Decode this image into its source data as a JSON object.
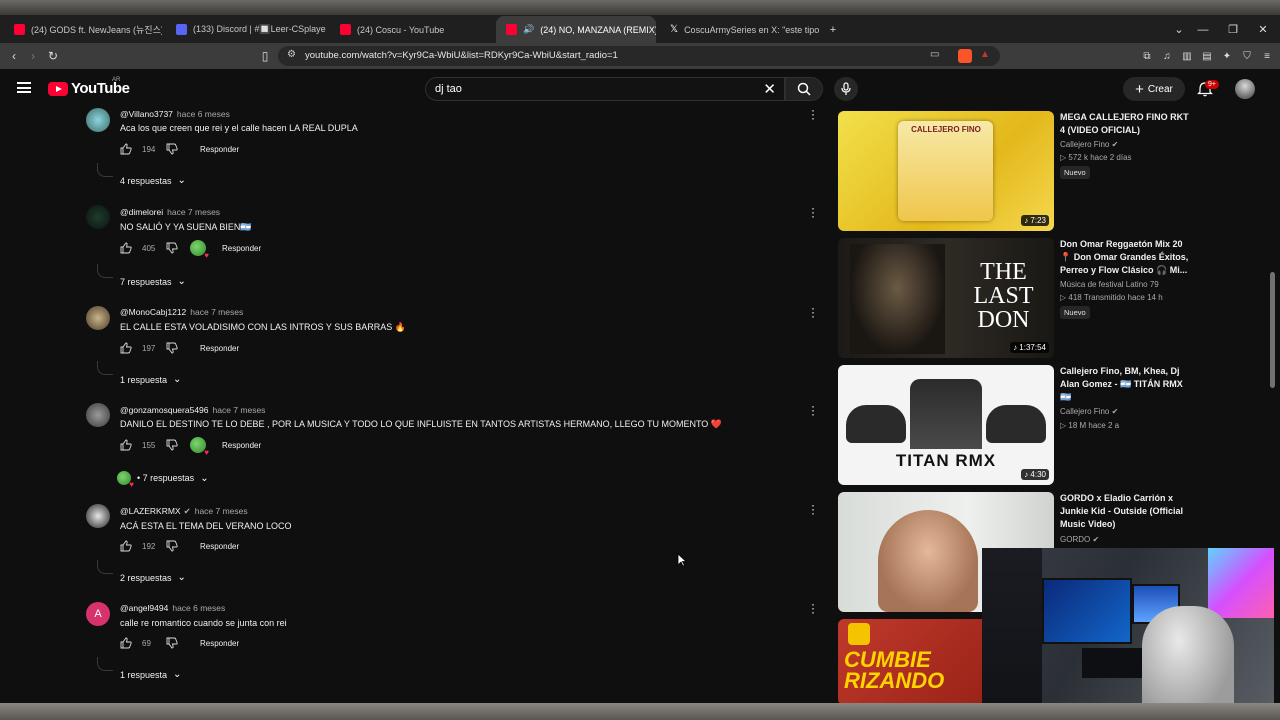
{
  "browser": {
    "tabs": [
      {
        "label": "(24) GODS ft. NewJeans (뉴진스) (Vid"
      },
      {
        "label": "(133) Discord | #🔲Leer-CSplayers"
      },
      {
        "label": "(24) Coscu - YouTube"
      },
      {
        "label": "(24) NO, MANZANA (REMIX)",
        "active": true
      },
      {
        "label": "CoscuArmySeries en X: \"este tipo me"
      }
    ],
    "url": "youtube.com/watch?v=Kyr9Ca-WbiU&list=RDKyr9Ca-WbiU&start_radio=1"
  },
  "youtube": {
    "logo": "YouTube",
    "country": "AR",
    "search_value": "dj tao",
    "create_label": "Crear",
    "notifications_badge": "9+"
  },
  "comments": [
    {
      "user": "@Villano3737",
      "time": "hace 6 meses",
      "text": "Aca los que creen que rei y el calle hacen LA REAL DUPLA",
      "likes": "194",
      "reply": "Responder",
      "replies": "4 respuestas"
    },
    {
      "user": "@dimelorei",
      "time": "hace 7 meses",
      "text": "NO SALIÓ  Y YA SUENA BIEN🇦🇷",
      "likes": "405",
      "reply": "Responder",
      "replies": "7 respuestas"
    },
    {
      "user": "@MonoCabj1212",
      "time": "hace 7 meses",
      "text": "EL CALLE ESTA VOLADISIMO CON LAS INTROS Y SUS BARRAS 🔥",
      "likes": "197",
      "reply": "Responder",
      "replies": "1 respuesta"
    },
    {
      "user": "@gonzamosquera5496",
      "time": "hace 7 meses",
      "text": "DANILO EL DESTINO TE LO DEBE , POR LA MUSICA Y TODO LO QUE INFLUISTE EN TANTOS ARTISTAS HERMANO, LLEGO TU MOMENTO ❤️",
      "likes": "155",
      "reply": "Responder",
      "replies": "• 7 respuestas"
    },
    {
      "user": "@LAZERKRMX",
      "time": "hace 7 meses",
      "text": "ACÁ ESTA EL TEMA DEL VERANO LOCO",
      "likes": "192",
      "reply": "Responder",
      "replies": "2 respuestas"
    },
    {
      "user": "@angel9494",
      "time": "hace 6 meses",
      "text": "calle re romantico cuando se junta con rei",
      "likes": "69",
      "reply": "Responder",
      "replies": "1 respuesta",
      "avatar_letter": "A"
    }
  ],
  "sidebar": [
    {
      "title": "MEGA CALLEJERO FINO RKT 4 (VIDEO OFICIAL)",
      "channel": "Callejero Fino",
      "views": "572 k",
      "age": "hace 2 días",
      "badge": "Nuevo",
      "duration": "7:23",
      "thumb_text": "CALLEJERO FINO"
    },
    {
      "title": "Don Omar Reggaetón Mix 20 📍 Don Omar Grandes Éxitos, Perreo y Flow Clásico 🎧 Mi...",
      "channel": "Música de festival Latino 79",
      "views": "418",
      "age": "Transmitido hace 14 h",
      "badge": "Nuevo",
      "duration": "1:37:54",
      "thumb_text": "THE LAST DON"
    },
    {
      "title": "Callejero Fino, BM, Khea, Dj Alan Gomez - 🇦🇷 TITÁN RMX 🇦🇷",
      "channel": "Callejero Fino",
      "views": "18 M",
      "age": "hace 2 a",
      "duration": "4:30",
      "thumb_text": "TITAN RMX"
    },
    {
      "title": "GORDO x Eladio Carrión x Junkie Kid - Outside (Official Music Video)",
      "channel": "GORDO"
    },
    {
      "title": "",
      "thumb_text": "CUMBIE RIZANDO"
    }
  ],
  "colors": {
    "bg": "#0f0f0f",
    "accent": "#ff0033",
    "muted": "#aaaaaa"
  }
}
